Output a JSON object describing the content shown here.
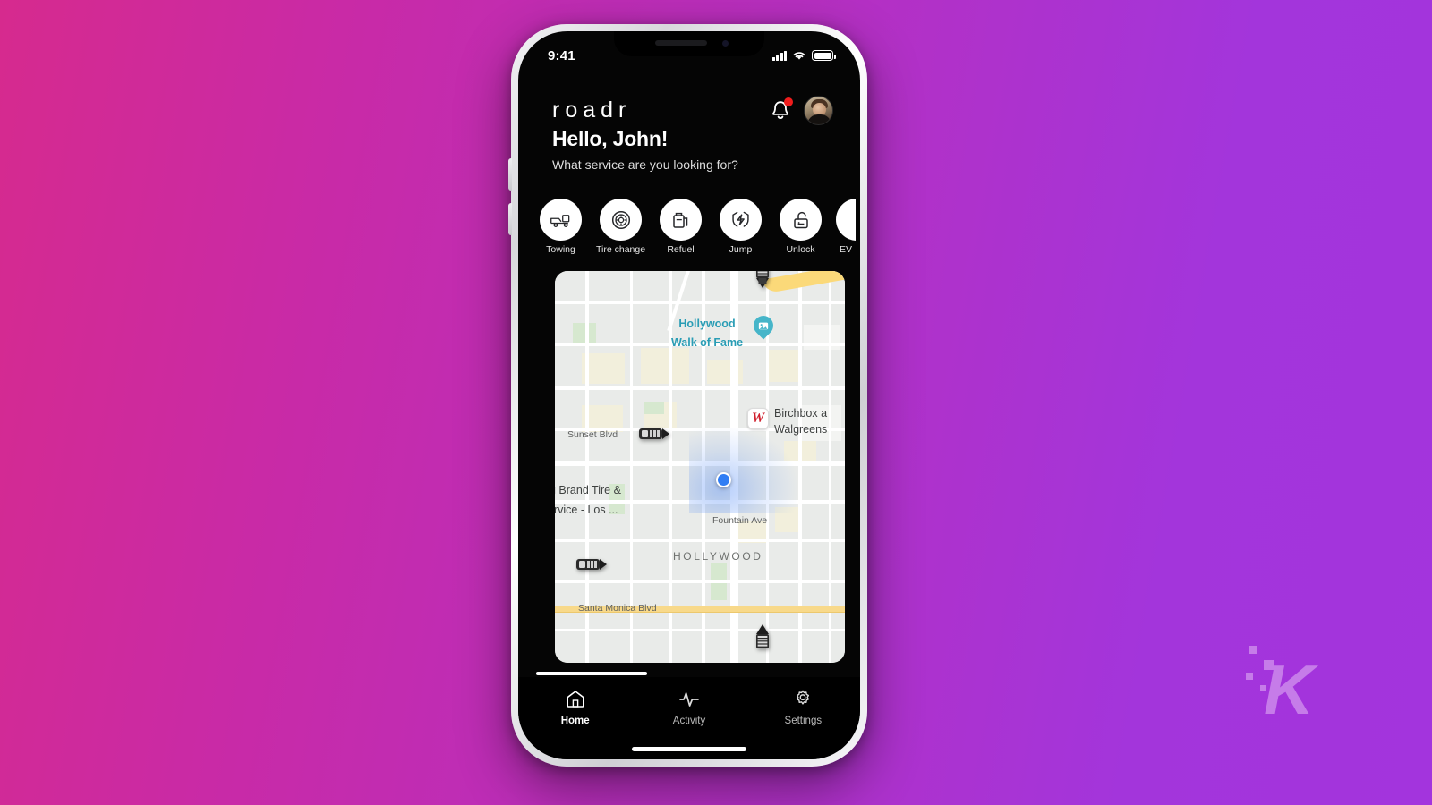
{
  "theme": {
    "bg_gradient_start": "#d62a8e",
    "bg_gradient_end": "#a334dd",
    "app_bg": "#050505",
    "accent_teal": "#2a9db5",
    "badge_red": "#ef1c1c",
    "user_dot_blue": "#2f7df4",
    "walgreens_red": "#d0202e"
  },
  "watermark": {
    "letter": "K"
  },
  "status_bar": {
    "time": "9:41",
    "signal_icon": "cellular-bars-icon",
    "wifi_icon": "wifi-icon",
    "battery_icon": "battery-full-icon"
  },
  "app_header": {
    "logo": "roadr",
    "bell_icon": "notification-bell-icon",
    "has_unread_badge": true,
    "avatar_icon": "user-avatar"
  },
  "greeting": {
    "title": "Hello, John!",
    "subtitle": "What service are you looking for?"
  },
  "services": [
    {
      "label": "Towing",
      "icon": "tow-truck-icon"
    },
    {
      "label": "Tire change",
      "icon": "tire-icon"
    },
    {
      "label": "Refuel",
      "icon": "fuel-can-icon"
    },
    {
      "label": "Jump",
      "icon": "jump-start-battery-icon"
    },
    {
      "label": "Unlock",
      "icon": "unlock-padlock-icon"
    },
    {
      "label": "EV",
      "icon": "ev-charge-icon"
    }
  ],
  "map": {
    "labels": [
      {
        "text": "Hollywood",
        "kind": "poi"
      },
      {
        "text": "Walk of Fame",
        "kind": "poi"
      },
      {
        "text": "Sunset Blvd",
        "kind": "street"
      },
      {
        "text": "Fountain Ave",
        "kind": "street"
      },
      {
        "text": "Santa Monica Blvd",
        "kind": "street"
      },
      {
        "text": "HOLLYWOOD",
        "kind": "neighborhood"
      },
      {
        "text": "g Brand Tire &",
        "kind": "business"
      },
      {
        "text": "ervice - Los ...",
        "kind": "business"
      },
      {
        "text": "Birchbox a",
        "kind": "business"
      },
      {
        "text": "Walgreens",
        "kind": "business"
      }
    ],
    "walgreens_mark": "W",
    "poi_pin_icon": "photo-pin-icon",
    "user_location_icon": "user-location-dot",
    "vehicle_markers": [
      {
        "type": "tow-truck-marker",
        "position": "top-center"
      },
      {
        "type": "car-marker",
        "position": "mid-left"
      },
      {
        "type": "car-marker",
        "position": "lower-left"
      },
      {
        "type": "tow-truck-marker",
        "position": "bottom-center"
      }
    ]
  },
  "tab_bar": {
    "items": [
      {
        "label": "Home",
        "icon": "home-icon",
        "active": true
      },
      {
        "label": "Activity",
        "icon": "activity-pulse-icon",
        "active": false
      },
      {
        "label": "Settings",
        "icon": "gear-icon",
        "active": false
      }
    ]
  }
}
